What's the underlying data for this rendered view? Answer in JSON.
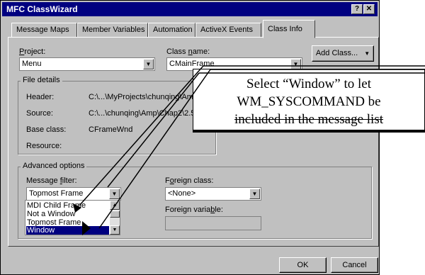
{
  "window": {
    "title": "MFC ClassWizard",
    "help_btn": "?",
    "close_btn": "✕"
  },
  "tabs": [
    {
      "label": "Message Maps"
    },
    {
      "label": "Member Variables"
    },
    {
      "label": "Automation"
    },
    {
      "label": "ActiveX Events"
    },
    {
      "label": "Class Info"
    }
  ],
  "project": {
    "label_pre": "",
    "label_u": "P",
    "label_post": "roject:",
    "value": "Menu"
  },
  "classname": {
    "label_pre": "Class ",
    "label_u": "n",
    "label_post": "ame:",
    "value": "CMainFrame"
  },
  "add_class_btn": "Add Class...",
  "file_details": {
    "title": "File details",
    "rows": [
      {
        "label": "Header:",
        "value": "C:\\...\\MyProjects\\chunqing\\Amp"
      },
      {
        "label": "Source:",
        "value": "C:\\...\\chunqing\\Amp\\Chap2\\2.5"
      },
      {
        "label": "Base class:",
        "value": "CFrameWnd"
      },
      {
        "label": "Resource:",
        "value": ""
      }
    ]
  },
  "advanced": {
    "title": "Advanced options",
    "message_filter": {
      "label_pre": "Message ",
      "label_u": "f",
      "label_post": "ilter:",
      "value": "Topmost Frame"
    },
    "list_items": [
      {
        "label": "MDI Child Frame"
      },
      {
        "label": "Not a Window"
      },
      {
        "label": "Topmost Frame"
      },
      {
        "label": "Window"
      }
    ],
    "foreign_class": {
      "label_pre": "F",
      "label_u": "o",
      "label_post": "reign class:",
      "value": "<None>"
    },
    "foreign_variable": {
      "label_pre": "Foreign varia",
      "label_u": "b",
      "label_post": "le:"
    }
  },
  "ok_btn": "OK",
  "cancel_btn": "Cancel",
  "callout": {
    "line1": "Select “Window” to let",
    "line2": "WM_SYSCOMMAND be",
    "line3": "included in the message list"
  },
  "icons": {
    "dropdown": "▼",
    "scroll_up": "▲",
    "scroll_down": "▼"
  }
}
